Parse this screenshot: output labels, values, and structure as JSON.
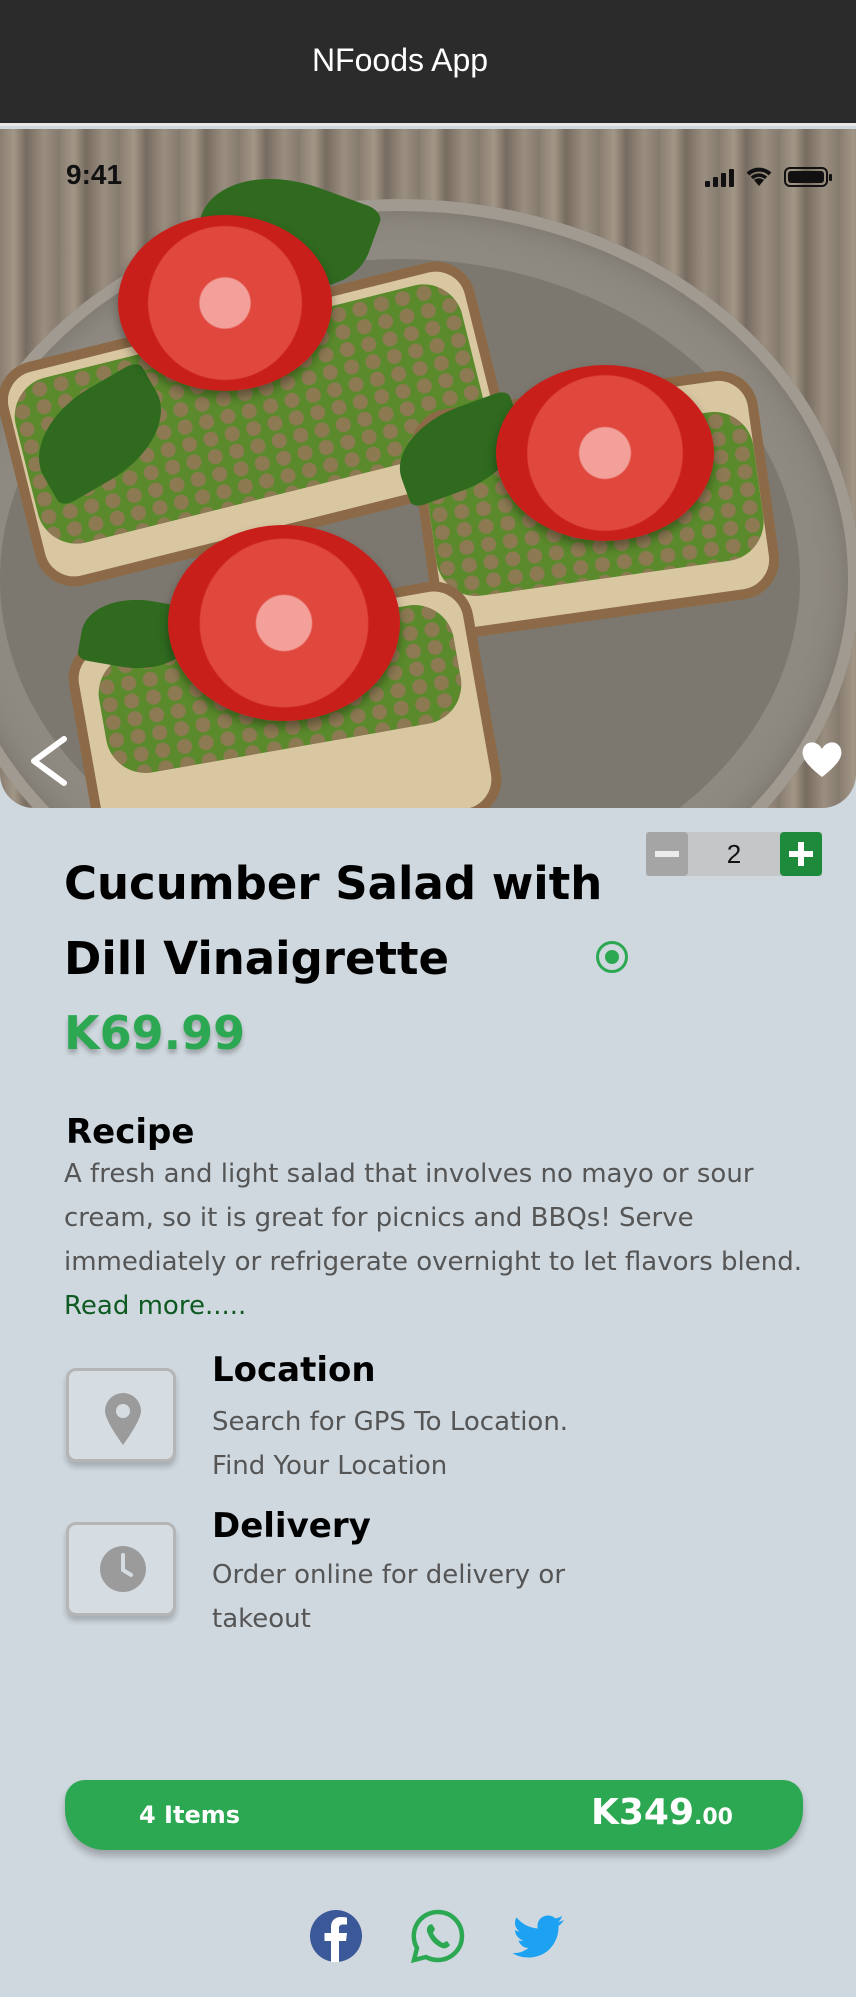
{
  "appbar": {
    "title": "NFoods App"
  },
  "status_bar": {
    "time": "9:41"
  },
  "product": {
    "title": "Cucumber Salad with Dill Vinaigrette",
    "price": "K69.99",
    "quantity": "2"
  },
  "recipe": {
    "title": "Recipe",
    "text": "A fresh and light salad that involves no mayo or sour cream, so it is great for picnics and BBQs! Serve immediately or refrigerate overnight to let flavors blend.",
    "read_more": "Read more....."
  },
  "location": {
    "title": "Location",
    "line1": "Search for GPS To Location.",
    "line2": "Find Your Location"
  },
  "delivery": {
    "title": "Delivery",
    "text": "Order online for delivery or takeout"
  },
  "cart": {
    "items": "4 Items",
    "total_main": "K349",
    "total_cents": ".00"
  },
  "social": [
    "facebook-icon",
    "whatsapp-icon",
    "twitter-icon"
  ],
  "colors": {
    "accent": "#2da852",
    "appbar": "#2b2b2b",
    "background": "#cfd8df",
    "plus_button": "#1e8a3c"
  }
}
